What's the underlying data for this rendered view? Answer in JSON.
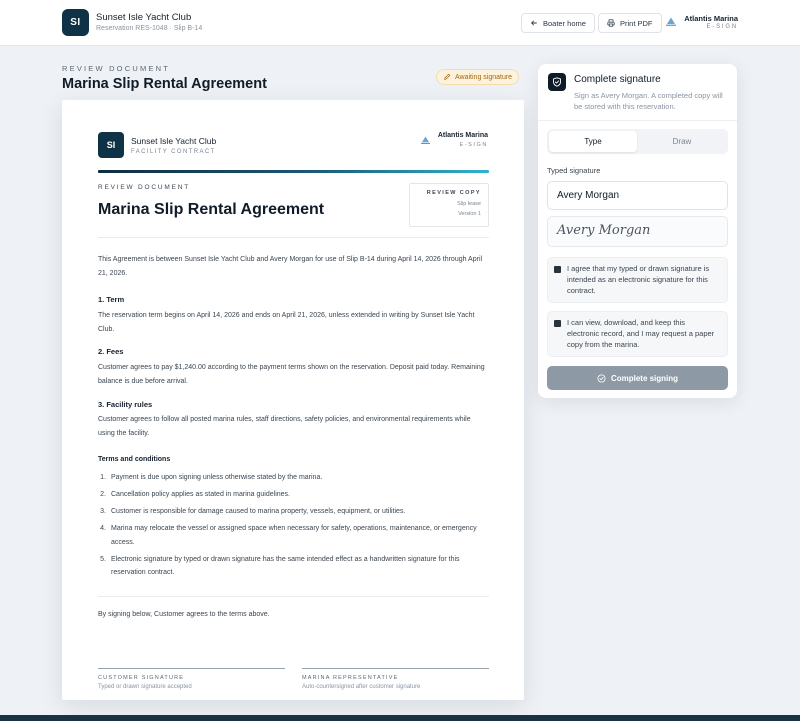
{
  "header": {
    "brand_mark": "SI",
    "brand_name": "Sunset Isle Yacht Club",
    "brand_sub": "Reservation RES-1048 · Slip B-14",
    "boater_home": "Boater home",
    "print_pdf": "Print PDF",
    "provider_name": "Atlantis Marina",
    "provider_sub": "E-SIGN"
  },
  "page": {
    "eyebrow": "REVIEW DOCUMENT",
    "title": "Marina Slip Rental Agreement",
    "status": "Awaiting signature"
  },
  "document": {
    "brand_mark": "SI",
    "brand_name": "Sunset Isle Yacht Club",
    "brand_sub": "FACILITY CONTRACT",
    "provider_name": "Atlantis Marina",
    "provider_sub": "E-SIGN",
    "eyebrow": "REVIEW DOCUMENT",
    "title": "Marina Slip Rental Agreement",
    "copy_label": "REVIEW COPY",
    "copy_type": "Slip lease",
    "copy_version": "Version 1",
    "intro": "This Agreement is between Sunset Isle Yacht Club and Avery Morgan for use of Slip B-14 during April 14, 2026 through April 21, 2026.",
    "sections": [
      {
        "heading": "1. Term",
        "text": "The reservation term begins on April 14, 2026 and ends on April 21, 2026, unless extended in writing by Sunset Isle Yacht Club."
      },
      {
        "heading": "2. Fees",
        "text": "Customer agrees to pay $1,240.00 according to the payment terms shown on the reservation. Deposit paid today. Remaining balance is due before arrival."
      },
      {
        "heading": "3. Facility rules",
        "text": "Customer agrees to follow all posted marina rules, staff directions, safety policies, and environmental requirements while using the facility."
      }
    ],
    "terms_heading": "Terms and conditions",
    "terms": [
      "Payment is due upon signing unless otherwise stated by the marina.",
      "Cancellation policy applies as stated in marina guidelines.",
      "Customer is responsible for damage caused to marina property, vessels, equipment, or utilities.",
      "Marina may relocate the vessel or assigned space when necessary for safety, operations, maintenance, or emergency access.",
      "Electronic signature by typed or drawn signature has the same intended effect as a handwritten signature for this reservation contract."
    ],
    "closing": "By signing below, Customer agrees to the terms above.",
    "customer_sig_label": "CUSTOMER SIGNATURE",
    "customer_sig_sub": "Typed or drawn signature accepted",
    "marina_sig_label": "MARINA REPRESENTATIVE",
    "marina_sig_sub": "Auto-countersigned after customer signature"
  },
  "panel": {
    "title": "Complete signature",
    "description": "Sign as Avery Morgan. A completed copy will be stored with this reservation.",
    "tab_type": "Type",
    "tab_draw": "Draw",
    "field_label": "Typed signature",
    "field_value": "Avery Morgan",
    "preview": "Avery Morgan",
    "consent_1": "I agree that my typed or drawn signature is intended as an electronic signature for this contract.",
    "consent_2": "I can view, download, and keep this electronic record, and I may request a paper copy from the marina.",
    "submit": "Complete signing"
  }
}
